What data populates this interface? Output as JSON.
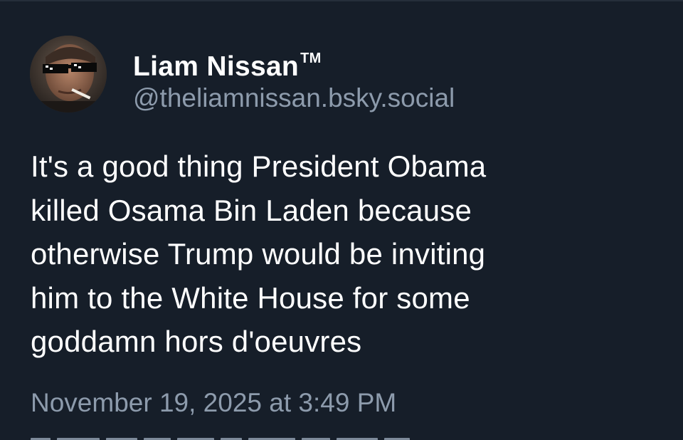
{
  "post": {
    "author": {
      "display_name": "Liam Nissan",
      "trademark": "TM",
      "handle": "@theliamnissan.bsky.social",
      "avatar_icon": "profile-photo-sunglasses-icon"
    },
    "text_lines": [
      "It's a good thing President Obama",
      "killed Osama Bin Laden because",
      "otherwise Trump would be inviting",
      "him to the White House for some",
      "goddamn hors d'oeuvres"
    ],
    "timestamp": "November 19, 2025 at 3:49 PM"
  },
  "colors": {
    "background": "#161e29",
    "primary_text": "#ffffff",
    "secondary_text": "#8d9bac"
  }
}
